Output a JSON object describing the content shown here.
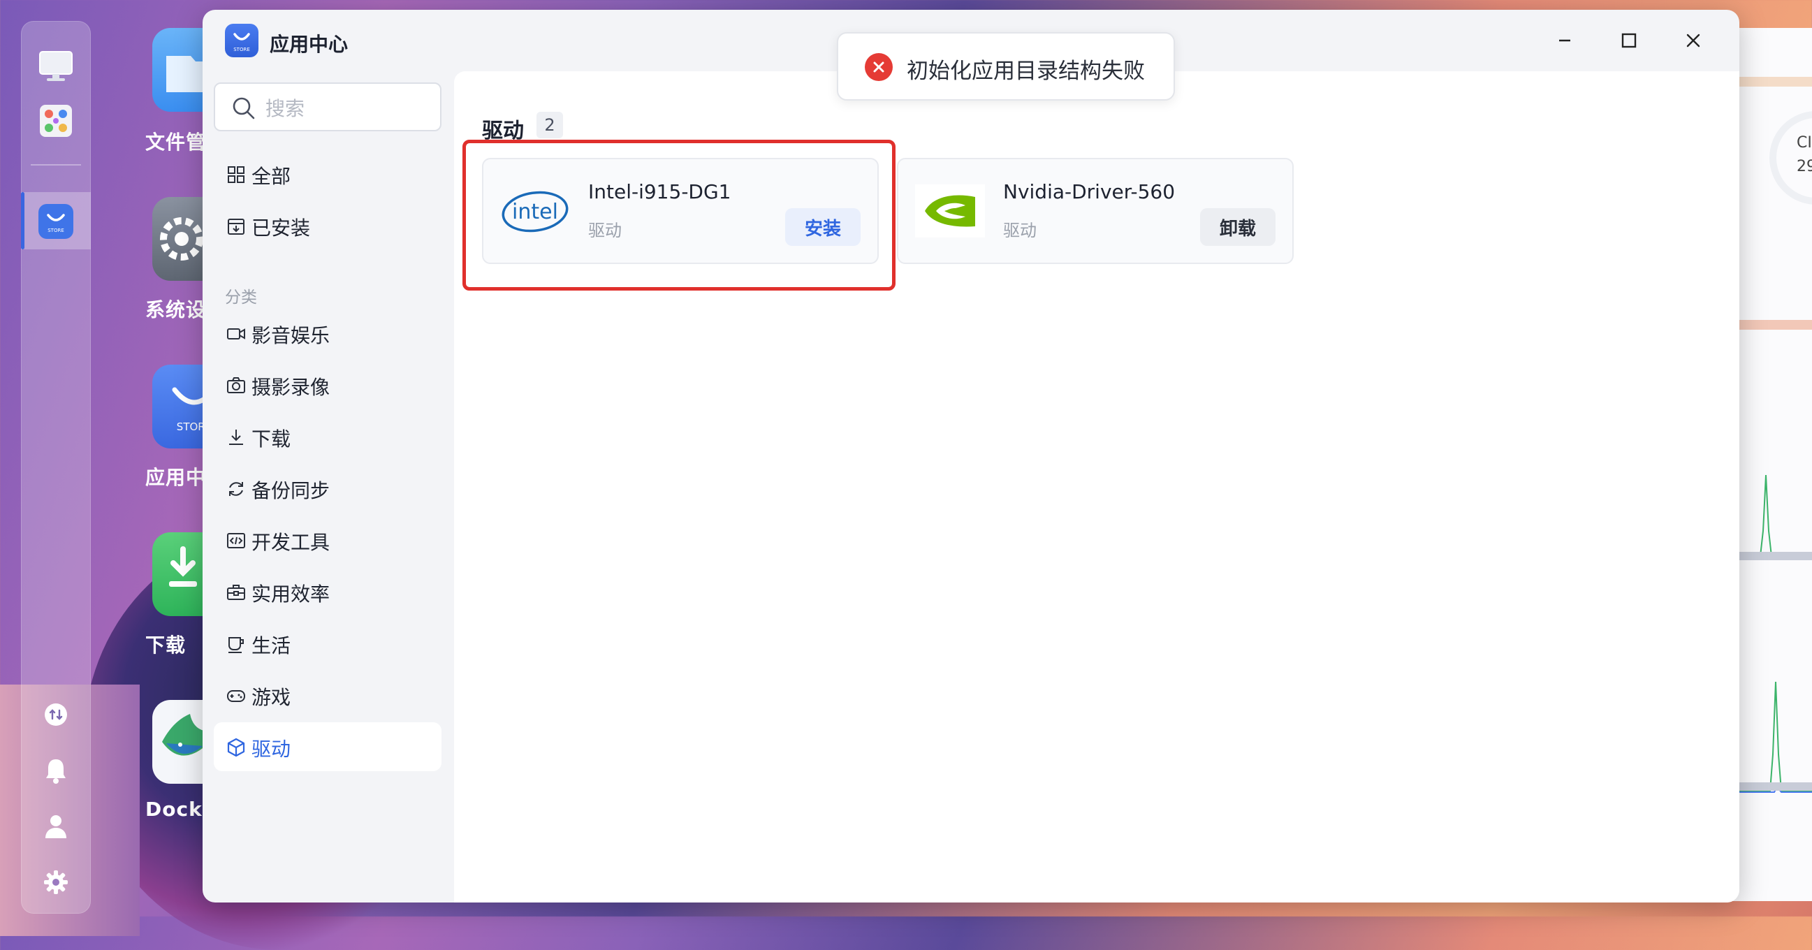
{
  "window": {
    "title": "应用中心"
  },
  "toast": {
    "message": "初始化应用目录结构失败"
  },
  "search": {
    "placeholder": "搜索",
    "value": ""
  },
  "sidebar": {
    "top_items": [
      {
        "label": "全部",
        "icon": "grid-icon"
      },
      {
        "label": "已安装",
        "icon": "installed-box-icon"
      }
    ],
    "section_label": "分类",
    "categories": [
      {
        "label": "影音娱乐",
        "icon": "video-camera-icon"
      },
      {
        "label": "摄影录像",
        "icon": "camera-icon"
      },
      {
        "label": "下载",
        "icon": "download-icon"
      },
      {
        "label": "备份同步",
        "icon": "sync-icon"
      },
      {
        "label": "开发工具",
        "icon": "code-icon"
      },
      {
        "label": "实用效率",
        "icon": "toolbox-icon"
      },
      {
        "label": "生活",
        "icon": "coffee-cup-icon"
      },
      {
        "label": "游戏",
        "icon": "gamepad-icon"
      },
      {
        "label": "驱动",
        "icon": "cube-icon",
        "active": true
      }
    ]
  },
  "content": {
    "title": "驱动",
    "count": "2",
    "apps": [
      {
        "name": "Intel-i915-DG1",
        "category": "驱动",
        "action": "安装",
        "logo_text": "intel",
        "logo": "intel-logo"
      },
      {
        "name": "Nvidia-Driver-560",
        "category": "驱动",
        "action": "卸载",
        "logo": "nvidia-logo"
      }
    ]
  },
  "desktop": {
    "icons": [
      {
        "label": "文件管",
        "color": "#4a9cf0"
      },
      {
        "label": "系统设",
        "color": "#7a8290"
      },
      {
        "label": "应用中",
        "color": "#3f74e8",
        "badge_text": "STORE"
      },
      {
        "label": "下载",
        "color": "#3cc46a"
      },
      {
        "label": "Docke",
        "color": "#f4f6fa"
      }
    ]
  },
  "peek": {
    "text_line1": "CI",
    "text_line2": "29"
  },
  "colors": {
    "accent": "#2f66e0",
    "error": "#e53b35",
    "highlight": "#e0302c"
  }
}
